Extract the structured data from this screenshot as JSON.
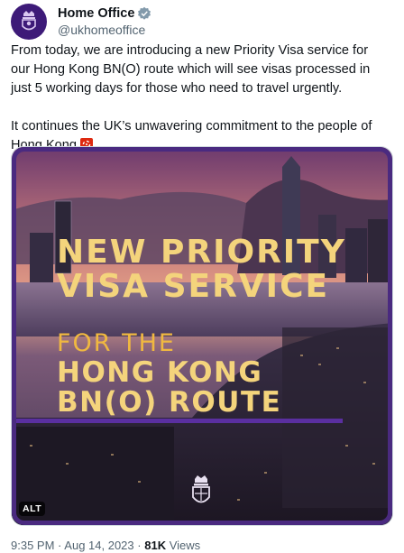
{
  "author": {
    "display_name": "Home Office",
    "handle": "@ukhomeoffice",
    "avatar_icon": "royal-crest-icon",
    "verified_icon": "verified-badge-icon"
  },
  "tweet": {
    "paragraph1": "From today, we are introducing a new Priority Visa service for our Hong Kong BN(O) route which will see visas processed in just 5 working days for those who need to travel urgently.",
    "paragraph2": "It continues the UK’s unwavering commitment to the people of Hong Kong",
    "flag_icon": "hong-kong-flag-icon"
  },
  "media": {
    "headline_line1": "NEW PRIORITY",
    "headline_line2": "VISA SERVICE",
    "sub_line1": "FOR THE",
    "sub_line2": "HONG KONG",
    "sub_line3": "BN(O) ROUTE",
    "alt_label": "ALT",
    "colors": {
      "frame": "#4a2a80",
      "headline": "#f4d47c",
      "sub": "#f0b840"
    }
  },
  "meta": {
    "time": "9:35 PM",
    "separator": "·",
    "date": "Aug 14, 2023",
    "views_count": "81K",
    "views_label": "Views"
  }
}
